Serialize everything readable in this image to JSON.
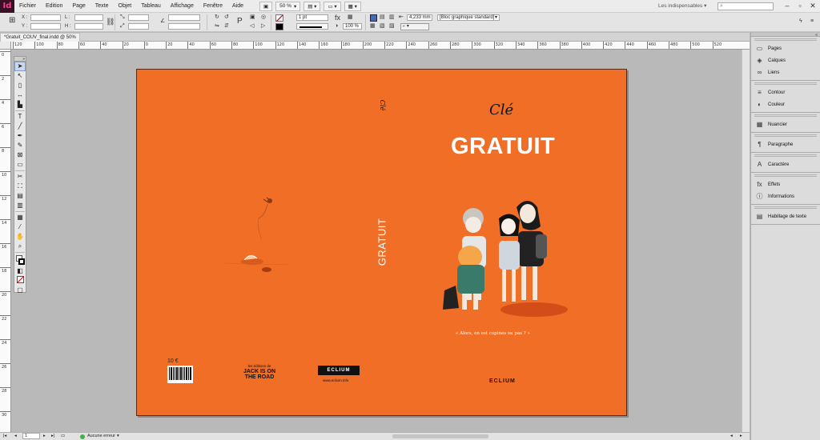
{
  "app": {
    "logo": "Id",
    "menus": [
      "Fichier",
      "Edition",
      "Page",
      "Texte",
      "Objet",
      "Tableau",
      "Affichage",
      "Fenêtre",
      "Aide"
    ],
    "zoom": "50 %",
    "workspace": "Les indispensables",
    "search_placeholder": ""
  },
  "controlbar": {
    "x_label": "X :",
    "y_label": "Y :",
    "l_label": "L :",
    "h_label": "H :",
    "stroke_weight": "1 pt",
    "opacity": "100 %",
    "measure": "4,233 mm",
    "style": "[Bloc graphique standard]"
  },
  "document": {
    "tab_title": "*Gratuit_COUV_final.indd @ 50%",
    "spread_color": "#f06e26"
  },
  "hruler_ticks": [
    "120",
    "100",
    "80",
    "60",
    "40",
    "20",
    "0",
    "20",
    "40",
    "60",
    "80",
    "100",
    "120",
    "140",
    "160",
    "180",
    "200",
    "220",
    "240",
    "260",
    "280",
    "300",
    "320",
    "340",
    "360",
    "380",
    "400",
    "420",
    "440",
    "460",
    "480",
    "500",
    "520"
  ],
  "vruler_ticks": [
    "0",
    "2",
    "4",
    "6",
    "8",
    "10",
    "12",
    "14",
    "16",
    "18",
    "20",
    "22",
    "24",
    "26",
    "28",
    "30"
  ],
  "cover": {
    "author": "Clé",
    "title": "GRATUIT",
    "spine_title": "GRATUIT",
    "tagline": "« Alors, on est copines ou pas ? »",
    "publisher": "ECLIUM",
    "back_price": "10 €",
    "back_collection_line1": "les éditions de",
    "back_collection_line2": "JACK IS ON",
    "back_collection_line3": "THE ROAD",
    "back_publisher": "ECLIUM",
    "back_website": "www.eclium.info",
    "spine_mark": "Clé"
  },
  "panels": [
    {
      "group": [
        {
          "icon": "pages-icon",
          "glyph": "▭",
          "label": "Pages"
        },
        {
          "icon": "layers-icon",
          "glyph": "◈",
          "label": "Calques"
        },
        {
          "icon": "links-icon",
          "glyph": "∞",
          "label": "Liens"
        }
      ]
    },
    {
      "group": [
        {
          "icon": "stroke-icon",
          "glyph": "≡",
          "label": "Contour"
        },
        {
          "icon": "color-icon",
          "glyph": "◐",
          "label": "Couleur"
        }
      ]
    },
    {
      "group": [
        {
          "icon": "swatches-icon",
          "glyph": "▦",
          "label": "Nuancier"
        }
      ]
    },
    {
      "group": [
        {
          "icon": "paragraph-icon",
          "glyph": "¶",
          "label": "Paragraphe"
        }
      ]
    },
    {
      "group": [
        {
          "icon": "character-icon",
          "glyph": "A",
          "label": "Caractère"
        }
      ]
    },
    {
      "group": [
        {
          "icon": "effects-icon",
          "glyph": "fx",
          "label": "Effets"
        },
        {
          "icon": "info-icon",
          "glyph": "ⓘ",
          "label": "Informations"
        }
      ]
    },
    {
      "group": [
        {
          "icon": "text-wrap-icon",
          "glyph": "▤",
          "label": "Habillage de texte"
        }
      ]
    }
  ],
  "statusbar": {
    "page_number": "1",
    "preflight": "Aucune erreur"
  }
}
